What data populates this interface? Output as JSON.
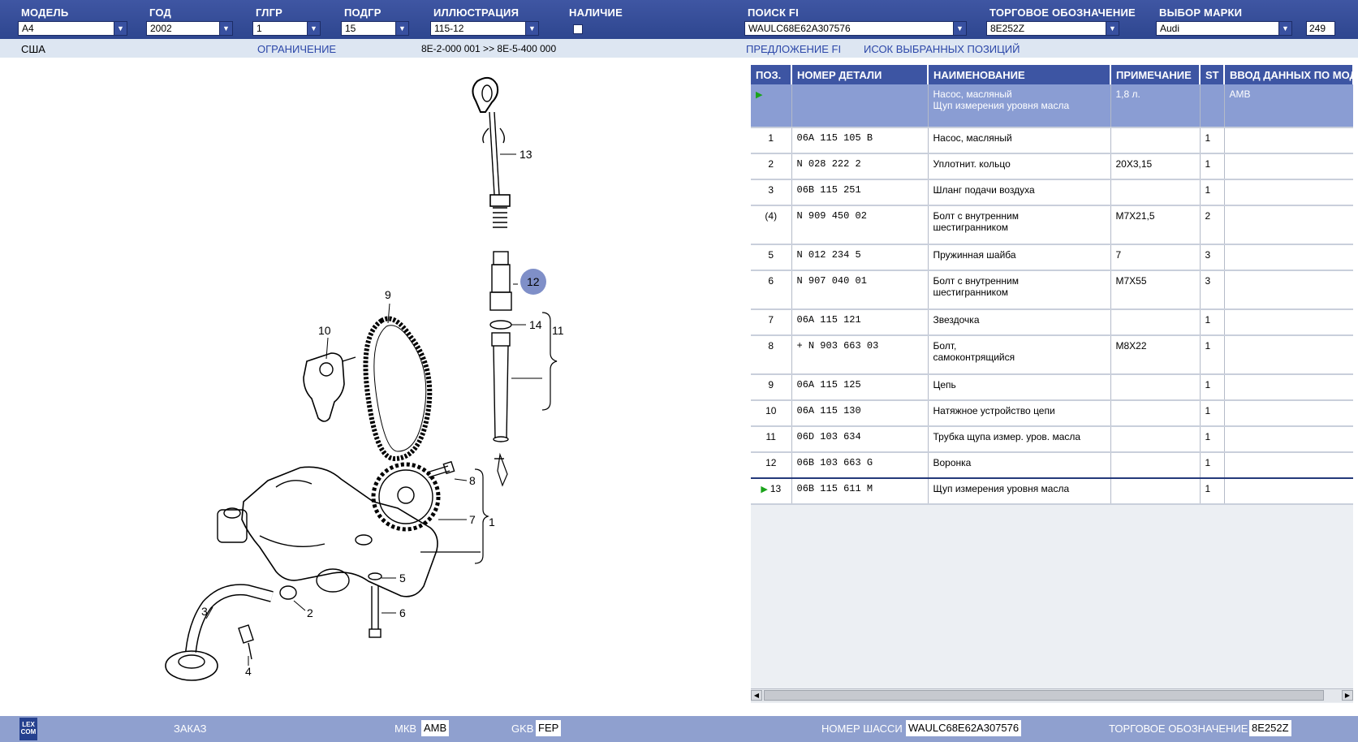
{
  "header": {
    "model": {
      "label": "МОДЕЛЬ",
      "value": "A4"
    },
    "year": {
      "label": "ГОД",
      "value": "2002"
    },
    "glgr": {
      "label": "ГЛГР",
      "value": "1"
    },
    "podgr": {
      "label": "ПОДГР",
      "value": "15"
    },
    "illustration": {
      "label": "ИЛЛЮСТРАЦИЯ",
      "value": "115-12"
    },
    "availability": {
      "label": "НАЛИЧИЕ"
    },
    "search_fi": {
      "label": "ПОИСК FI",
      "value": "WAULC68E62A307576"
    },
    "trade_designation": {
      "label": "ТОРГОВОЕ ОБОЗНАЧЕНИЕ",
      "value": "8E252Z"
    },
    "brand": {
      "label": "ВЫБОР МАРКИ",
      "value": "Audi"
    },
    "count": "249"
  },
  "subbar": {
    "region": "США",
    "restriction_link": "ОГРАНИЧЕНИЕ",
    "range": "8E-2-000 001 >> 8E-5-400 000",
    "offer_link": "ПРЕДЛОЖЕНИЕ FI",
    "selected_list_link": "ИСОК ВЫБРАННЫХ ПОЗИЦИЙ"
  },
  "table": {
    "columns": [
      "ПОЗ.",
      "НОМЕР ДЕТАЛИ",
      "НАИМЕНОВАНИЕ",
      "ПРИМЕЧАНИЕ",
      "ST",
      "ВВОД ДАННЫХ ПО МОДЕЛИ"
    ],
    "group_row": {
      "name": "Насос, масляный\nЩуп измерения уровня масла",
      "note": "1,8 л.",
      "model_data": "AMB"
    },
    "rows": [
      {
        "pos": "1",
        "part": "  06A  115  105  B",
        "name": "Насос, масляный",
        "note": "",
        "st": "1"
      },
      {
        "pos": "2",
        "part": "  N    028  222  2",
        "name": "Уплотнит. кольцо",
        "note": "20X3,15",
        "st": "1"
      },
      {
        "pos": "3",
        "part": "  06B  115  251",
        "name": "Шланг подачи воздуха",
        "note": "",
        "st": "1"
      },
      {
        "pos": "(4)",
        "part": "  N    909  450  02",
        "name": "Болт с внутренним\nшестигранником",
        "note": "M7X21,5",
        "st": "2"
      },
      {
        "pos": "5",
        "part": "  N    012  234  5",
        "name": "Пружинная шайба",
        "note": "7",
        "st": "3"
      },
      {
        "pos": "6",
        "part": "  N    907  040  01",
        "name": "Болт с внутренним\nшестигранником",
        "note": "M7X55",
        "st": "3"
      },
      {
        "pos": "7",
        "part": "  06A  115  121",
        "name": "Звездочка",
        "note": "",
        "st": "1"
      },
      {
        "pos": "8",
        "part": "+ N    903  663  03",
        "name": "Болт,\nсамоконтрящийся",
        "note": "M8X22",
        "st": "1"
      },
      {
        "pos": "9",
        "part": "  06A  115  125",
        "name": "Цепь",
        "note": "",
        "st": "1"
      },
      {
        "pos": "10",
        "part": "  06A  115  130",
        "name": "Натяжное устройство цепи",
        "note": "",
        "st": "1"
      },
      {
        "pos": "11",
        "part": "  06D  103  634",
        "name": "Трубка щупа измер. уров. масла",
        "note": "",
        "st": "1"
      },
      {
        "pos": "12",
        "part": "  06B  103  663  G",
        "name": "Воронка",
        "note": "",
        "st": "1"
      },
      {
        "pos": "13",
        "part": "  06B  115  611  M",
        "name": "Щуп измерения уровня масла",
        "note": "",
        "st": "1"
      }
    ]
  },
  "diagram": {
    "callouts": [
      "1",
      "2",
      "3",
      "4",
      "5",
      "6",
      "7",
      "8",
      "9",
      "10",
      "11",
      "12",
      "13",
      "14"
    ]
  },
  "footer": {
    "logo": "LEX\nCOM",
    "order_link": "ЗАКАЗ",
    "mkb_label": "МКВ",
    "mkb_value": "AMB",
    "gkb_label": "GKB",
    "gkb_value": "FEP",
    "chassis_label": "НОМЕР ШАССИ",
    "chassis_value": "WAULC68E62A307576",
    "trade_label": "ТОРГОВОЕ ОБОЗНАЧЕНИЕ",
    "trade_value": "8E252Z"
  },
  "colors": {
    "header_bg": "#3f56a3",
    "table_header": "#3d55a3",
    "group_row": "#8a9dd3",
    "highlight_callout": "#7f8fc8"
  }
}
